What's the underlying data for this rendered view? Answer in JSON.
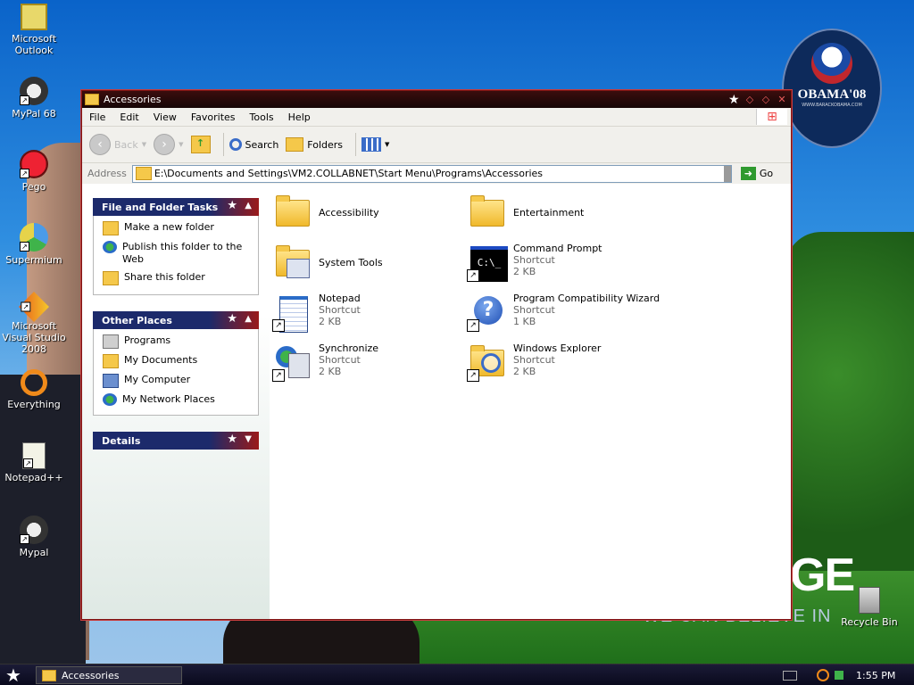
{
  "desktop": {
    "icons": [
      {
        "label": "Microsoft Outlook",
        "icon": "outlook-icon"
      },
      {
        "label": "MyPal 68",
        "icon": "mypal-icon"
      },
      {
        "label": "Pego",
        "icon": "pego-icon"
      },
      {
        "label": "Supermium",
        "icon": "supermium-icon"
      },
      {
        "label": "Microsoft Visual Studio 2008",
        "icon": "visual-studio-icon"
      },
      {
        "label": "Everything",
        "icon": "everything-icon"
      },
      {
        "label": "Notepad++",
        "icon": "notepadpp-icon"
      },
      {
        "label": "Mypal",
        "icon": "mypal-icon"
      }
    ],
    "recycle_bin": "Recycle Bin",
    "wallpaper": {
      "badge_text": "OBAMA'08",
      "badge_sub": "WWW.BARACKOBAMA.COM",
      "slogan_big": "GE",
      "slogan_small": "WE CAN BELIEVE IN"
    }
  },
  "window": {
    "title": "Accessories",
    "menu": [
      "File",
      "Edit",
      "View",
      "Favorites",
      "Tools",
      "Help"
    ],
    "toolbar": {
      "back": "Back",
      "search": "Search",
      "folders": "Folders"
    },
    "address": {
      "label": "Address",
      "value": "E:\\Documents and Settings\\VM2.COLLABNET\\Start Menu\\Programs\\Accessories",
      "go": "Go"
    },
    "tasks_panel": {
      "title": "File and Folder Tasks",
      "items": [
        "Make a new folder",
        "Publish this folder to the Web",
        "Share this folder"
      ]
    },
    "places_panel": {
      "title": "Other Places",
      "items": [
        "Programs",
        "My Documents",
        "My Computer",
        "My Network Places"
      ]
    },
    "details_panel": {
      "title": "Details"
    },
    "files": [
      {
        "name": "Accessibility",
        "type": "",
        "size": "",
        "icon": "folder-icon"
      },
      {
        "name": "Entertainment",
        "type": "",
        "size": "",
        "icon": "folder-icon"
      },
      {
        "name": "System Tools",
        "type": "",
        "size": "",
        "icon": "folder-icon"
      },
      {
        "name": "Command Prompt",
        "type": "Shortcut",
        "size": "2 KB",
        "icon": "command-prompt-icon"
      },
      {
        "name": "Notepad",
        "type": "Shortcut",
        "size": "2 KB",
        "icon": "notepad-icon"
      },
      {
        "name": "Program Compatibility Wizard",
        "type": "Shortcut",
        "size": "1 KB",
        "icon": "help-icon"
      },
      {
        "name": "Synchronize",
        "type": "Shortcut",
        "size": "2 KB",
        "icon": "synchronize-icon"
      },
      {
        "name": "Windows Explorer",
        "type": "Shortcut",
        "size": "2 KB",
        "icon": "explorer-icon"
      }
    ]
  },
  "taskbar": {
    "task": "Accessories",
    "clock": "1:55 PM"
  }
}
